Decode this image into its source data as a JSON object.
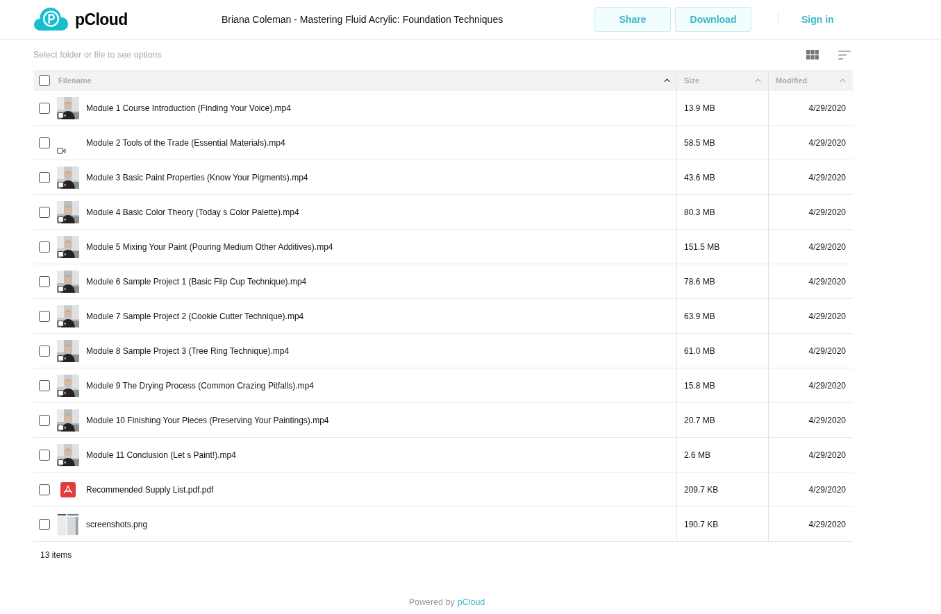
{
  "header": {
    "logo_text": "pCloud",
    "title": "Briana Coleman - Mastering Fluid Acrylic: Foundation Techniques",
    "buttons": [
      "Share",
      "Download"
    ],
    "sign_in": "Sign in"
  },
  "toolbar": {
    "hint": "Select folder or file to see options"
  },
  "table": {
    "select_all": {
      "checked": false
    },
    "columns": [
      {
        "label": "Filename",
        "sorted": true
      },
      {
        "label": "Size",
        "sorted": false
      },
      {
        "label": "Modified",
        "sorted": false
      }
    ],
    "rows": [
      {
        "kind": "video-thumb",
        "checked": false,
        "name": "Module 1 Course Introduction (Finding Your Voice).mp4",
        "size": "13.9 MB",
        "modified": "4/29/2020"
      },
      {
        "kind": "video",
        "checked": false,
        "name": "Module 2 Tools of the Trade (Essential Materials).mp4",
        "size": "58.5 MB",
        "modified": "4/29/2020"
      },
      {
        "kind": "video-thumb",
        "checked": false,
        "name": "Module 3 Basic Paint Properties (Know Your Pigments).mp4",
        "size": "43.6 MB",
        "modified": "4/29/2020"
      },
      {
        "kind": "video-thumb",
        "checked": false,
        "name": "Module 4 Basic Color Theory (Today s Color Palette).mp4",
        "size": "80.3 MB",
        "modified": "4/29/2020"
      },
      {
        "kind": "video-thumb",
        "checked": false,
        "name": "Module 5 Mixing Your Paint (Pouring Medium Other Additives).mp4",
        "size": "151.5 MB",
        "modified": "4/29/2020"
      },
      {
        "kind": "video-thumb",
        "checked": false,
        "name": "Module 6 Sample Project 1 (Basic Flip Cup Technique).mp4",
        "size": "78.6 MB",
        "modified": "4/29/2020"
      },
      {
        "kind": "video-thumb",
        "checked": false,
        "name": "Module 7 Sample Project 2 (Cookie Cutter Technique).mp4",
        "size": "63.9 MB",
        "modified": "4/29/2020"
      },
      {
        "kind": "video-thumb",
        "checked": false,
        "name": "Module 8 Sample Project 3 (Tree Ring Technique).mp4",
        "size": "61.0 MB",
        "modified": "4/29/2020"
      },
      {
        "kind": "video-thumb",
        "checked": false,
        "name": "Module 9 The Drying Process (Common Crazing Pitfalls).mp4",
        "size": "15.8 MB",
        "modified": "4/29/2020"
      },
      {
        "kind": "video-thumb",
        "checked": false,
        "name": "Module 10 Finishing Your Pieces (Preserving Your Paintings).mp4",
        "size": "20.7 MB",
        "modified": "4/29/2020"
      },
      {
        "kind": "video-thumb",
        "checked": false,
        "name": "Module 11 Conclusion (Let s Paint!).mp4",
        "size": "2.6 MB",
        "modified": "4/29/2020"
      },
      {
        "kind": "pdf",
        "checked": false,
        "name": "Recommended Supply List.pdf.pdf",
        "size": "209.7 KB",
        "modified": "4/29/2020"
      },
      {
        "kind": "image-thumb",
        "checked": false,
        "name": "screenshots.png",
        "size": "190.7 KB",
        "modified": "4/29/2020"
      }
    ]
  },
  "footer": {
    "count": "13 items",
    "powered_by": "Powered by",
    "brand": "pCloud"
  }
}
